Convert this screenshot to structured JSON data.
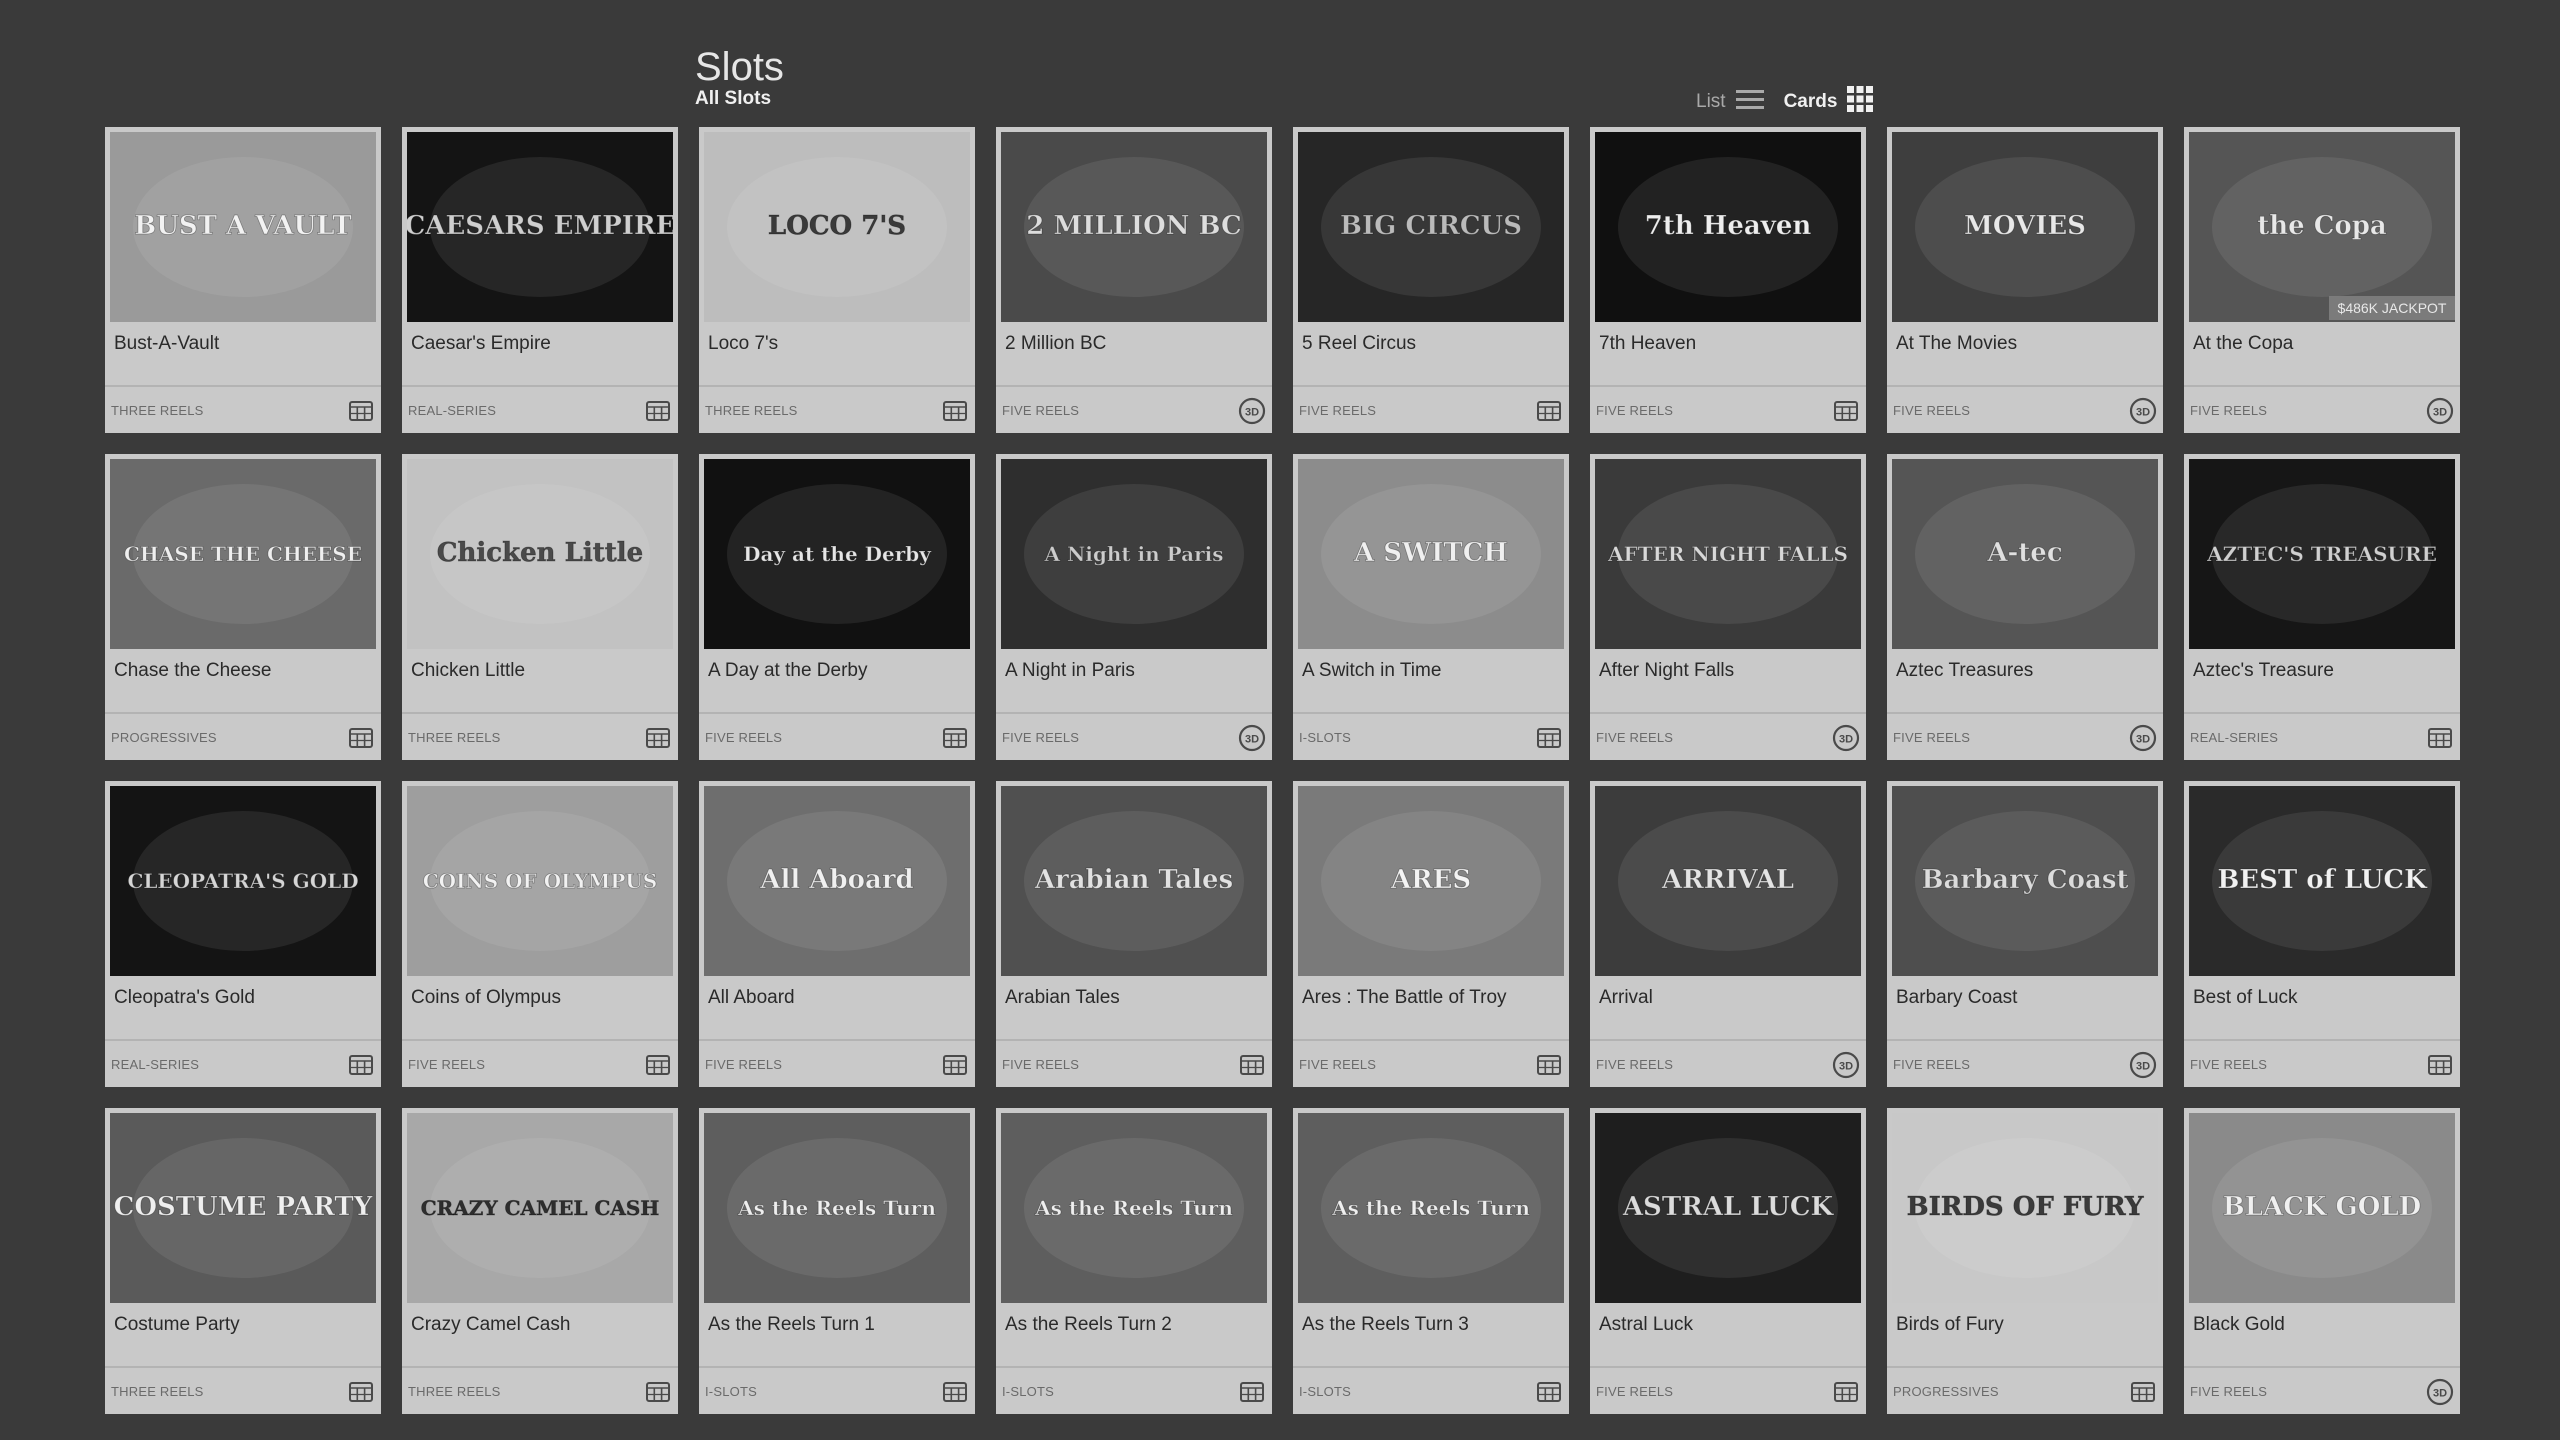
{
  "page": {
    "title": "Slots",
    "subtitle": "All Slots"
  },
  "view_toggle": {
    "list_label": "List",
    "cards_label": "Cards",
    "active": "Cards"
  },
  "games": [
    {
      "title": "Bust-A-Vault",
      "category": "THREE REELS",
      "type_icon": "reels-icon",
      "art": "BUST A VAULT",
      "bg": "#9a9a9a",
      "fg": "#f2f2f2"
    },
    {
      "title": "Caesar's Empire",
      "category": "REAL-SERIES",
      "type_icon": "reels-icon",
      "art": "CAESARS EMPIRE",
      "bg": "#141414",
      "fg": "#cfcfcf"
    },
    {
      "title": "Loco 7's",
      "category": "THREE REELS",
      "type_icon": "reels-icon",
      "art": "LOCO 7'S",
      "bg": "#bdbdbd",
      "fg": "#3a3a3a"
    },
    {
      "title": "2 Million BC",
      "category": "FIVE REELS",
      "type_icon": "3d-icon",
      "art": "2 MILLION BC",
      "bg": "#4a4a4a",
      "fg": "#dddddd"
    },
    {
      "title": "5 Reel Circus",
      "category": "FIVE REELS",
      "type_icon": "reels-icon",
      "art": "BIG CIRCUS",
      "bg": "#262626",
      "fg": "#bbbbbb"
    },
    {
      "title": "7th Heaven",
      "category": "FIVE REELS",
      "type_icon": "reels-icon",
      "art": "7th Heaven",
      "bg": "#101010",
      "fg": "#eeeeee"
    },
    {
      "title": "At The Movies",
      "category": "FIVE REELS",
      "type_icon": "3d-icon",
      "art": "MOVIES",
      "bg": "#3e3e3e",
      "fg": "#e8e8e8"
    },
    {
      "title": "At the Copa",
      "category": "FIVE REELS",
      "type_icon": "3d-icon",
      "art": "the Copa",
      "bg": "#555555",
      "fg": "#e8e8e8",
      "badge": "$486K JACKPOT"
    },
    {
      "title": "Chase the Cheese",
      "category": "PROGRESSIVES",
      "type_icon": "reels-icon",
      "art": "CHASE THE CHEESE",
      "bg": "#6a6a6a",
      "fg": "#efefef"
    },
    {
      "title": "Chicken Little",
      "category": "THREE REELS",
      "type_icon": "reels-icon",
      "art": "Chicken Little",
      "bg": "#c2c2c2",
      "fg": "#4a4a4a"
    },
    {
      "title": "A Day at the Derby",
      "category": "FIVE REELS",
      "type_icon": "reels-icon",
      "art": "Day at the Derby",
      "bg": "#111111",
      "fg": "#e6e6e6"
    },
    {
      "title": "A Night in Paris",
      "category": "FIVE REELS",
      "type_icon": "3d-icon",
      "art": "A Night in Paris",
      "bg": "#2e2e2e",
      "fg": "#cccccc"
    },
    {
      "title": "A Switch in Time",
      "category": "I-SLOTS",
      "type_icon": "reels-icon",
      "art": "A SWITCH",
      "bg": "#8c8c8c",
      "fg": "#f0f0f0"
    },
    {
      "title": "After Night Falls",
      "category": "FIVE REELS",
      "type_icon": "3d-icon",
      "art": "AFTER NIGHT FALLS",
      "bg": "#3a3a3a",
      "fg": "#d8d8d8"
    },
    {
      "title": "Aztec Treasures",
      "category": "FIVE REELS",
      "type_icon": "3d-icon",
      "art": "A-tec",
      "bg": "#555555",
      "fg": "#e0e0e0"
    },
    {
      "title": "Aztec's Treasure",
      "category": "REAL-SERIES",
      "type_icon": "reels-icon",
      "art": "AZTEC'S TREASURE",
      "bg": "#161616",
      "fg": "#d0d0d0"
    },
    {
      "title": "Cleopatra's Gold",
      "category": "REAL-SERIES",
      "type_icon": "reels-icon",
      "art": "CLEOPATRA'S GOLD",
      "bg": "#141414",
      "fg": "#d6d6d6"
    },
    {
      "title": "Coins of Olympus",
      "category": "FIVE REELS",
      "type_icon": "reels-icon",
      "art": "COINS OF OLYMPUS",
      "bg": "#9e9e9e",
      "fg": "#f2f2f2"
    },
    {
      "title": "All Aboard",
      "category": "FIVE REELS",
      "type_icon": "reels-icon",
      "art": "All Aboard",
      "bg": "#6e6e6e",
      "fg": "#f0f0f0"
    },
    {
      "title": "Arabian Tales",
      "category": "FIVE REELS",
      "type_icon": "reels-icon",
      "art": "Arabian Tales",
      "bg": "#505050",
      "fg": "#e2e2e2"
    },
    {
      "title": "Ares : The Battle of Troy",
      "category": "FIVE REELS",
      "type_icon": "reels-icon",
      "art": "ARES",
      "bg": "#7a7a7a",
      "fg": "#f4f4f4"
    },
    {
      "title": "Arrival",
      "category": "FIVE REELS",
      "type_icon": "3d-icon",
      "art": "ARRIVAL",
      "bg": "#3c3c3c",
      "fg": "#e4e4e4"
    },
    {
      "title": "Barbary Coast",
      "category": "FIVE REELS",
      "type_icon": "3d-icon",
      "art": "Barbary Coast",
      "bg": "#4e4e4e",
      "fg": "#dcdcdc"
    },
    {
      "title": "Best of Luck",
      "category": "FIVE REELS",
      "type_icon": "reels-icon",
      "art": "BEST of LUCK",
      "bg": "#2a2a2a",
      "fg": "#f2f2f2"
    },
    {
      "title": "Costume Party",
      "category": "THREE REELS",
      "type_icon": "reels-icon",
      "art": "COSTUME PARTY",
      "bg": "#5a5a5a",
      "fg": "#efefef"
    },
    {
      "title": "Crazy Camel Cash",
      "category": "THREE REELS",
      "type_icon": "reels-icon",
      "art": "CRAZY CAMEL CASH",
      "bg": "#a8a8a8",
      "fg": "#2e2e2e"
    },
    {
      "title": "As the Reels Turn 1",
      "category": "I-SLOTS",
      "type_icon": "reels-icon",
      "art": "As the Reels Turn",
      "bg": "#5e5e5e",
      "fg": "#efefef"
    },
    {
      "title": "As the Reels Turn 2",
      "category": "I-SLOTS",
      "type_icon": "reels-icon",
      "art": "As the Reels Turn",
      "bg": "#5e5e5e",
      "fg": "#efefef"
    },
    {
      "title": "As the Reels Turn 3",
      "category": "I-SLOTS",
      "type_icon": "reels-icon",
      "art": "As the Reels Turn",
      "bg": "#5e5e5e",
      "fg": "#efefef"
    },
    {
      "title": "Astral Luck",
      "category": "FIVE REELS",
      "type_icon": "reels-icon",
      "art": "ASTRAL LUCK",
      "bg": "#1e1e1e",
      "fg": "#dcdcdc"
    },
    {
      "title": "Birds of Fury",
      "category": "PROGRESSIVES",
      "type_icon": "reels-icon",
      "art": "BIRDS OF FURY",
      "bg": "#c8c8c8",
      "fg": "#3a3a3a"
    },
    {
      "title": "Black Gold",
      "category": "FIVE REELS",
      "type_icon": "3d-icon",
      "art": "BLACK GOLD",
      "bg": "#8a8a8a",
      "fg": "#f0f0f0"
    }
  ]
}
